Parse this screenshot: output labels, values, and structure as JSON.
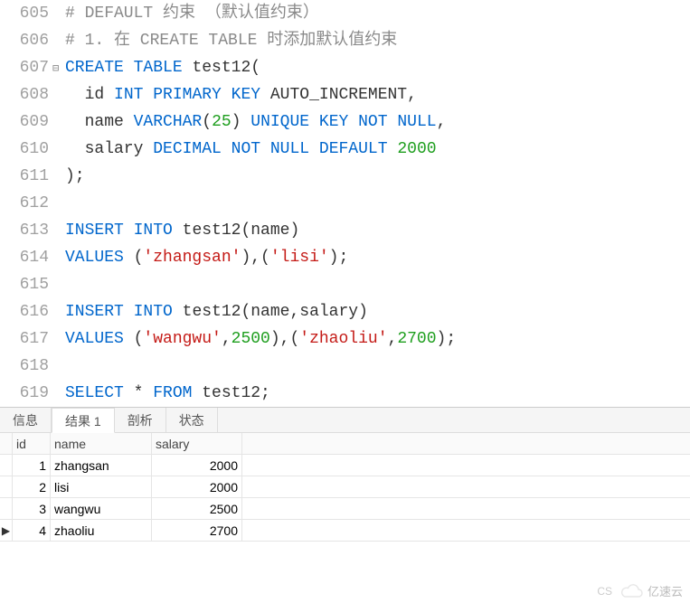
{
  "code": {
    "lines": [
      {
        "num": "605",
        "fold": "",
        "tokens": [
          {
            "t": "# DEFAULT 约束 （默认值约束）",
            "c": "c-gray"
          }
        ]
      },
      {
        "num": "606",
        "fold": "",
        "tokens": [
          {
            "t": "# 1. 在 CREATE TABLE 时添加默认值约束",
            "c": "c-gray"
          }
        ]
      },
      {
        "num": "607",
        "fold": "⊟",
        "tokens": [
          {
            "t": "CREATE",
            "c": "c-blue"
          },
          {
            "t": " ",
            "c": ""
          },
          {
            "t": "TABLE",
            "c": "c-blue"
          },
          {
            "t": " test12(",
            "c": "c-black"
          }
        ]
      },
      {
        "num": "608",
        "fold": "",
        "tokens": [
          {
            "t": "  id ",
            "c": "c-black"
          },
          {
            "t": "INT",
            "c": "c-blue"
          },
          {
            "t": " ",
            "c": ""
          },
          {
            "t": "PRIMARY",
            "c": "c-blue"
          },
          {
            "t": " ",
            "c": ""
          },
          {
            "t": "KEY",
            "c": "c-blue"
          },
          {
            "t": " AUTO_INCREMENT,",
            "c": "c-black"
          }
        ]
      },
      {
        "num": "609",
        "fold": "",
        "tokens": [
          {
            "t": "  name ",
            "c": "c-black"
          },
          {
            "t": "VARCHAR",
            "c": "c-blue"
          },
          {
            "t": "(",
            "c": "c-black"
          },
          {
            "t": "25",
            "c": "c-green"
          },
          {
            "t": ") ",
            "c": "c-black"
          },
          {
            "t": "UNIQUE",
            "c": "c-blue"
          },
          {
            "t": " ",
            "c": ""
          },
          {
            "t": "KEY",
            "c": "c-blue"
          },
          {
            "t": " ",
            "c": ""
          },
          {
            "t": "NOT",
            "c": "c-blue"
          },
          {
            "t": " ",
            "c": ""
          },
          {
            "t": "NULL",
            "c": "c-blue"
          },
          {
            "t": ",",
            "c": "c-black"
          }
        ]
      },
      {
        "num": "610",
        "fold": "",
        "tokens": [
          {
            "t": "  salary ",
            "c": "c-black"
          },
          {
            "t": "DECIMAL",
            "c": "c-blue"
          },
          {
            "t": " ",
            "c": ""
          },
          {
            "t": "NOT",
            "c": "c-blue"
          },
          {
            "t": " ",
            "c": ""
          },
          {
            "t": "NULL",
            "c": "c-blue"
          },
          {
            "t": " ",
            "c": ""
          },
          {
            "t": "DEFAULT",
            "c": "c-blue"
          },
          {
            "t": " ",
            "c": ""
          },
          {
            "t": "2000",
            "c": "c-green"
          }
        ]
      },
      {
        "num": "611",
        "fold": "",
        "tokens": [
          {
            "t": ");",
            "c": "c-black"
          }
        ]
      },
      {
        "num": "612",
        "fold": "",
        "tokens": []
      },
      {
        "num": "613",
        "fold": "",
        "tokens": [
          {
            "t": "INSERT",
            "c": "c-blue"
          },
          {
            "t": " ",
            "c": ""
          },
          {
            "t": "INTO",
            "c": "c-blue"
          },
          {
            "t": " test12(name)",
            "c": "c-black"
          }
        ]
      },
      {
        "num": "614",
        "fold": "",
        "tokens": [
          {
            "t": "VALUES",
            "c": "c-blue"
          },
          {
            "t": " (",
            "c": "c-black"
          },
          {
            "t": "'zhangsan'",
            "c": "c-red"
          },
          {
            "t": "),(",
            "c": "c-black"
          },
          {
            "t": "'lisi'",
            "c": "c-red"
          },
          {
            "t": ");",
            "c": "c-black"
          }
        ]
      },
      {
        "num": "615",
        "fold": "",
        "tokens": []
      },
      {
        "num": "616",
        "fold": "",
        "tokens": [
          {
            "t": "INSERT",
            "c": "c-blue"
          },
          {
            "t": " ",
            "c": ""
          },
          {
            "t": "INTO",
            "c": "c-blue"
          },
          {
            "t": " test12(name,salary)",
            "c": "c-black"
          }
        ]
      },
      {
        "num": "617",
        "fold": "",
        "tokens": [
          {
            "t": "VALUES",
            "c": "c-blue"
          },
          {
            "t": " (",
            "c": "c-black"
          },
          {
            "t": "'wangwu'",
            "c": "c-red"
          },
          {
            "t": ",",
            "c": "c-black"
          },
          {
            "t": "2500",
            "c": "c-green"
          },
          {
            "t": "),(",
            "c": "c-black"
          },
          {
            "t": "'zhaoliu'",
            "c": "c-red"
          },
          {
            "t": ",",
            "c": "c-black"
          },
          {
            "t": "2700",
            "c": "c-green"
          },
          {
            "t": ");",
            "c": "c-black"
          }
        ]
      },
      {
        "num": "618",
        "fold": "",
        "tokens": []
      },
      {
        "num": "619",
        "fold": "",
        "tokens": [
          {
            "t": "SELECT",
            "c": "c-blue"
          },
          {
            "t": " * ",
            "c": "c-black"
          },
          {
            "t": "FROM",
            "c": "c-blue"
          },
          {
            "t": " test12;",
            "c": "c-black"
          }
        ]
      }
    ]
  },
  "tabs": {
    "items": [
      "信息",
      "结果 1",
      "剖析",
      "状态"
    ],
    "active_index": 1
  },
  "result": {
    "columns": [
      "id",
      "name",
      "salary"
    ],
    "rows": [
      {
        "ptr": "",
        "id": "1",
        "name": "zhangsan",
        "salary": "2000"
      },
      {
        "ptr": "",
        "id": "2",
        "name": "lisi",
        "salary": "2000"
      },
      {
        "ptr": "",
        "id": "3",
        "name": "wangwu",
        "salary": "2500"
      },
      {
        "ptr": "▶",
        "id": "4",
        "name": "zhaoliu",
        "salary": "2700"
      }
    ]
  },
  "watermark": {
    "text": "亿速云",
    "cs": "CS"
  }
}
